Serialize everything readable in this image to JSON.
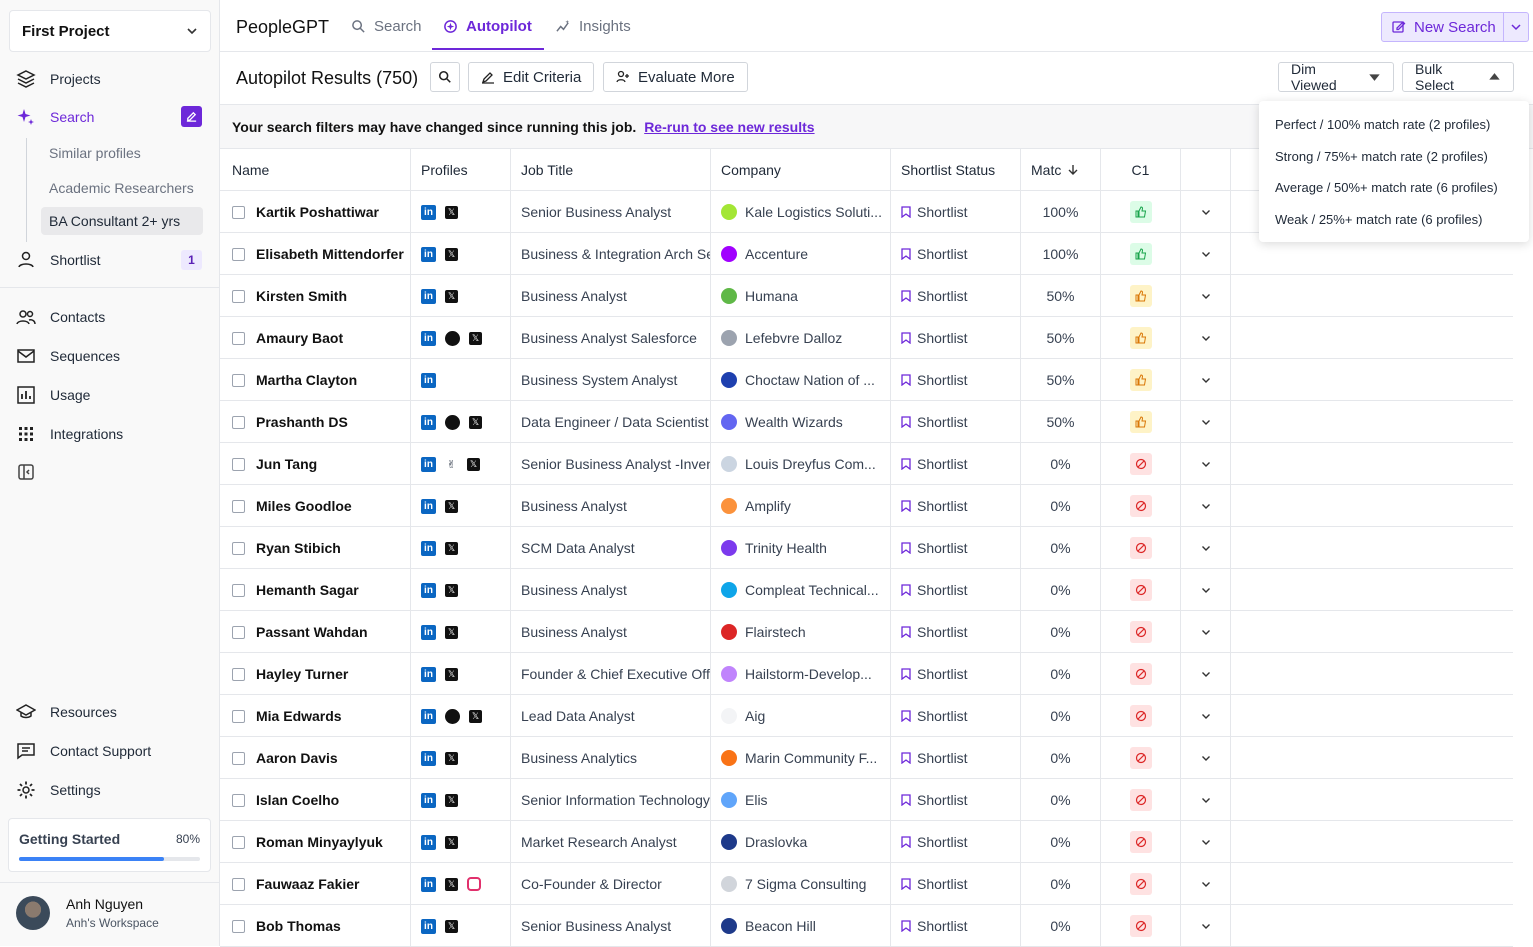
{
  "sidebar": {
    "project": "First Project",
    "nav": {
      "projects": "Projects",
      "search": "Search",
      "similar": "Similar profiles",
      "academic": "Academic Researchers",
      "ba": "BA Consultant 2+ yrs",
      "shortlist": "Shortlist",
      "shortlist_count": "1",
      "contacts": "Contacts",
      "sequences": "Sequences",
      "usage": "Usage",
      "integrations": "Integrations",
      "resources": "Resources",
      "support": "Contact Support",
      "settings": "Settings"
    },
    "getting_started": {
      "label": "Getting Started",
      "pct_text": "80%",
      "progress": 0.8
    },
    "user": {
      "name": "Anh Nguyen",
      "workspace": "Anh's Workspace"
    }
  },
  "topbar": {
    "brand": "PeopleGPT",
    "tabs": {
      "search": "Search",
      "autopilot": "Autopilot",
      "insights": "Insights"
    },
    "new_search": "New Search"
  },
  "results": {
    "title": "Autopilot Results (750)",
    "edit_criteria": "Edit Criteria",
    "evaluate_more": "Evaluate More",
    "dim_viewed": "Dim Viewed",
    "bulk_select": "Bulk Select"
  },
  "banner": {
    "text": "Your search filters may have changed since running this job.",
    "link": "Re-run to see new results"
  },
  "table": {
    "headers": {
      "name": "Name",
      "profiles": "Profiles",
      "job": "Job Title",
      "company": "Company",
      "status": "Shortlist Status",
      "match": "Matc",
      "c1": "C1"
    },
    "rows": [
      {
        "name": "Kartik Poshattiwar",
        "profiles": [
          "li",
          "x"
        ],
        "job": "Senior Business Analyst",
        "company": "Kale Logistics Soluti...",
        "logo": "#a3e635",
        "status": "Shortlist",
        "match": "100%",
        "c1": "good"
      },
      {
        "name": "Elisabeth Mittendorfer",
        "profiles": [
          "li",
          "x"
        ],
        "job": "Business & Integration Arch Se",
        "company": "Accenture",
        "logo": "#a100ff",
        "status": "Shortlist",
        "match": "100%",
        "c1": "good"
      },
      {
        "name": "Kirsten Smith",
        "profiles": [
          "li",
          "x"
        ],
        "job": "Business Analyst",
        "company": "Humana",
        "logo": "#5fb847",
        "status": "Shortlist",
        "match": "50%",
        "c1": "mid"
      },
      {
        "name": "Amaury Baot",
        "profiles": [
          "li",
          "gh",
          "x"
        ],
        "job": "Business Analyst Salesforce",
        "company": "Lefebvre Dalloz",
        "logo": "#9ca3af",
        "status": "Shortlist",
        "match": "50%",
        "c1": "mid"
      },
      {
        "name": "Martha Clayton",
        "profiles": [
          "li"
        ],
        "job": "Business System Analyst",
        "company": "Choctaw Nation of ...",
        "logo": "#1e40af",
        "status": "Shortlist",
        "match": "50%",
        "c1": "mid"
      },
      {
        "name": "Prashanth DS",
        "profiles": [
          "li",
          "gh",
          "x"
        ],
        "job": "Data Engineer / Data Scientist ,",
        "company": "Wealth Wizards",
        "logo": "#6366f1",
        "status": "Shortlist",
        "match": "50%",
        "c1": "mid"
      },
      {
        "name": "Jun Tang",
        "profiles": [
          "li",
          "hand",
          "x"
        ],
        "job": "Senior Business Analyst -Inven",
        "company": "Louis Dreyfus Com...",
        "logo": "#cbd5e1",
        "status": "Shortlist",
        "match": "0%",
        "c1": "bad"
      },
      {
        "name": "Miles Goodloe",
        "profiles": [
          "li",
          "x"
        ],
        "job": "Business Analyst",
        "company": "Amplify",
        "logo": "#fb923c",
        "status": "Shortlist",
        "match": "0%",
        "c1": "bad"
      },
      {
        "name": "Ryan Stibich",
        "profiles": [
          "li",
          "x"
        ],
        "job": "SCM Data Analyst",
        "company": "Trinity Health",
        "logo": "#7c3aed",
        "status": "Shortlist",
        "match": "0%",
        "c1": "bad"
      },
      {
        "name": "Hemanth Sagar",
        "profiles": [
          "li",
          "x"
        ],
        "job": "Business Analyst",
        "company": "Compleat Technical...",
        "logo": "#0ea5e9",
        "status": "Shortlist",
        "match": "0%",
        "c1": "bad"
      },
      {
        "name": "Passant Wahdan",
        "profiles": [
          "li",
          "x"
        ],
        "job": "Business Analyst",
        "company": "Flairstech",
        "logo": "#dc2626",
        "status": "Shortlist",
        "match": "0%",
        "c1": "bad"
      },
      {
        "name": "Hayley Turner",
        "profiles": [
          "li",
          "x"
        ],
        "job": "Founder & Chief Executive Offi",
        "company": "Hailstorm-Develop...",
        "logo": "#c084fc",
        "status": "Shortlist",
        "match": "0%",
        "c1": "bad"
      },
      {
        "name": "Mia Edwards",
        "profiles": [
          "li",
          "gh",
          "x"
        ],
        "job": "Lead Data Analyst",
        "company": "Aig",
        "logo": "#f3f4f6",
        "status": "Shortlist",
        "match": "0%",
        "c1": "bad"
      },
      {
        "name": "Aaron Davis",
        "profiles": [
          "li",
          "x"
        ],
        "job": "Business Analytics",
        "company": "Marin Community F...",
        "logo": "#f97316",
        "status": "Shortlist",
        "match": "0%",
        "c1": "bad"
      },
      {
        "name": "Islan Coelho",
        "profiles": [
          "li",
          "x"
        ],
        "job": "Senior Information Technology",
        "company": "Elis",
        "logo": "#60a5fa",
        "status": "Shortlist",
        "match": "0%",
        "c1": "bad"
      },
      {
        "name": "Roman Minyaylyuk",
        "profiles": [
          "li",
          "x"
        ],
        "job": "Market Research Analyst",
        "company": "Draslovka",
        "logo": "#1e3a8a",
        "status": "Shortlist",
        "match": "0%",
        "c1": "bad"
      },
      {
        "name": "Fauwaaz Fakier",
        "profiles": [
          "li",
          "x",
          "ig"
        ],
        "job": "Co-Founder & Director",
        "company": "7 Sigma Consulting",
        "logo": "#d1d5db",
        "status": "Shortlist",
        "match": "0%",
        "c1": "bad"
      },
      {
        "name": "Bob Thomas",
        "profiles": [
          "li",
          "x"
        ],
        "job": "Senior Business Analyst",
        "company": "Beacon Hill",
        "logo": "#1e3a8a",
        "status": "Shortlist",
        "match": "0%",
        "c1": "bad"
      }
    ]
  },
  "dropdown": {
    "items": [
      "Perfect / 100% match rate (2 profiles)",
      "Strong / 75%+ match rate (2 profiles)",
      "Average / 50%+ match rate (6 profiles)",
      "Weak / 25%+ match rate (6 profiles)"
    ]
  }
}
